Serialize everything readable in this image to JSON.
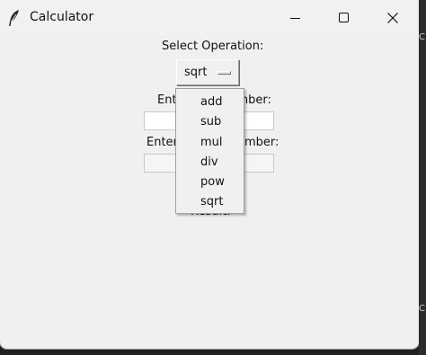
{
  "window": {
    "title": "Calculator",
    "icon": "feather-icon"
  },
  "form": {
    "select_label": "Select Operation:",
    "selected_operation": "sqrt",
    "first_number_label": "Enter First Number:",
    "second_number_label": "Enter Second Number:",
    "first_number_value": "",
    "second_number_value": "",
    "result_label": "Result:"
  },
  "dropdown": {
    "options": [
      "add",
      "sub",
      "mul",
      "div",
      "pow",
      "sqrt"
    ]
  },
  "background_window": {
    "fragments": [
      "C",
      "C"
    ]
  },
  "colors": {
    "window_bg": "#f0f0f0",
    "titlebar_bg": "#f3f0f0",
    "entry_bg": "#ffffff"
  }
}
